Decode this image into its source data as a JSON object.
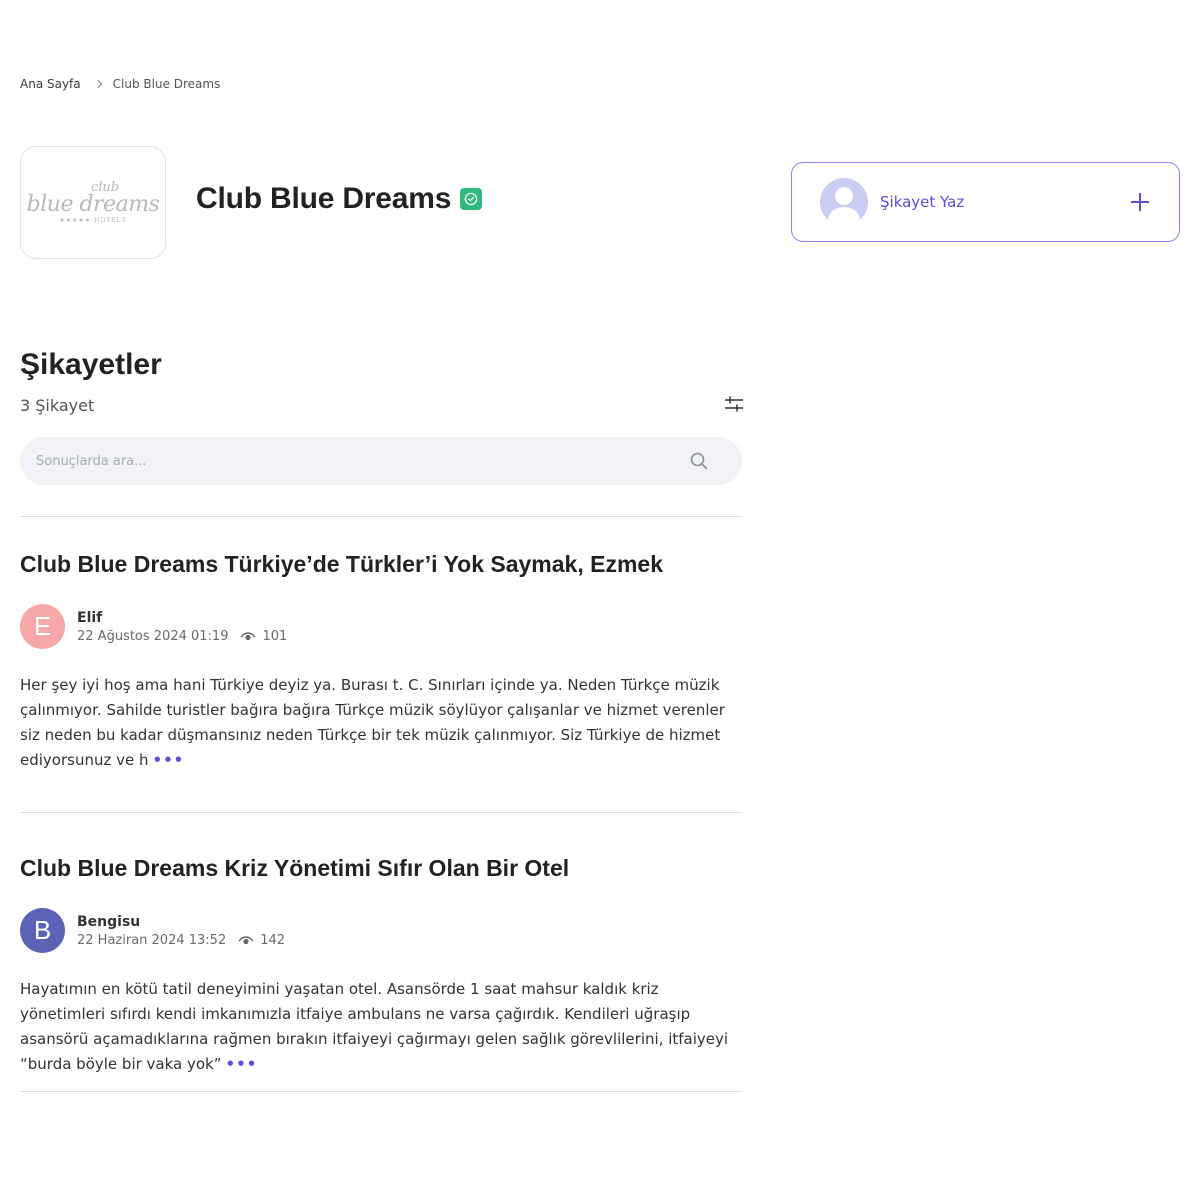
{
  "breadcrumb": {
    "home": "Ana Sayfa",
    "current": "Club Blue Dreams"
  },
  "brand": {
    "name": "Club Blue Dreams",
    "logo_text": {
      "top": "club",
      "main": "blue dreams",
      "bottom": "★★★★★ HOTELS"
    }
  },
  "write_card": {
    "label": "Şikayet Yaz"
  },
  "complaints": {
    "title": "Şikayetler",
    "count": "3 Şikayet",
    "search_placeholder": "Sonuçlarda ara..."
  },
  "posts": [
    {
      "title": "Club Blue Dreams Türkiye’de Türkler’i Yok Saymak, Ezmek",
      "author": "Elif",
      "avatar_letter": "E",
      "avatar_color": "#f6a8a8",
      "date": "22 Ağustos 2024 01:19",
      "views": "101",
      "body": "Her şey iyi hoş ama hani Türkiye deyiz ya. Burası t. C. Sınırları içinde ya. Neden Türkçe müzik çalınmıyor. Sahilde turistler bağıra bağıra Türkçe müzik söylüyor çalışanlar ve hizmet verenler siz neden bu kadar düşmansınız neden Türkçe bir tek müzik çalınmıyor. Siz Türkiye de hizmet ediyorsunuz ve h",
      "more": "•••"
    },
    {
      "title": "Club Blue Dreams Kriz Yönetimi Sıfır Olan Bir Otel",
      "author": "Bengisu",
      "avatar_letter": "B",
      "avatar_color": "#5b63b7",
      "date": "22 Haziran 2024 13:52",
      "views": "142",
      "body": "Hayatımın en kötü tatil deneyimini yaşatan otel. Asansörde 1 saat mahsur kaldık kriz yönetimleri sıfırdı kendi imkanımızla itfaiye ambulans ne varsa çağırdık. Kendileri uğraşıp asansörü açamadıklarına rağmen bırakın itfaiyeyi çağırmayı gelen sağlık görevlilerini, itfaiyeyi “burda böyle bir vaka yok”",
      "more": "•••"
    }
  ],
  "colors": {
    "accent": "#5b4fd6",
    "verified": "#2fba7f",
    "search_bg": "#f1f2f6"
  }
}
